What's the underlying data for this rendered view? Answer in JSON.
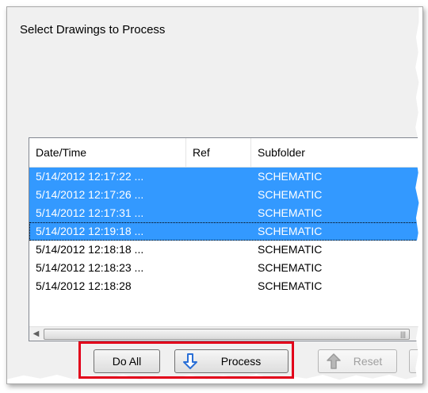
{
  "dialog": {
    "title": "Select Drawings to Process"
  },
  "list": {
    "columns": [
      {
        "label": "Date/Time"
      },
      {
        "label": "Ref"
      },
      {
        "label": "Subfolder"
      }
    ],
    "rows": [
      {
        "datetime": "5/14/2012 12:17:22 ...",
        "ref": "",
        "subfolder": "SCHEMATIC",
        "selected": true
      },
      {
        "datetime": "5/14/2012 12:17:26 ...",
        "ref": "",
        "subfolder": "SCHEMATIC",
        "selected": true
      },
      {
        "datetime": "5/14/2012 12:17:31 ...",
        "ref": "",
        "subfolder": "SCHEMATIC",
        "selected": true
      },
      {
        "datetime": "5/14/2012 12:19:18 ...",
        "ref": "",
        "subfolder": "SCHEMATIC",
        "selected": true
      },
      {
        "datetime": "5/14/2012 12:18:18 ...",
        "ref": "",
        "subfolder": "SCHEMATIC",
        "selected": false
      },
      {
        "datetime": "5/14/2012 12:18:23 ...",
        "ref": "",
        "subfolder": "SCHEMATIC",
        "selected": false
      },
      {
        "datetime": "5/14/2012 12:18:28",
        "ref": "",
        "subfolder": "SCHEMATIC",
        "selected": false
      }
    ]
  },
  "buttons": {
    "do_all": "Do All",
    "process": "Process",
    "reset": "Reset"
  },
  "colors": {
    "selection": "#3399ff",
    "highlight_box": "#e2001a",
    "arrow_blue": "#2a6fd6"
  }
}
